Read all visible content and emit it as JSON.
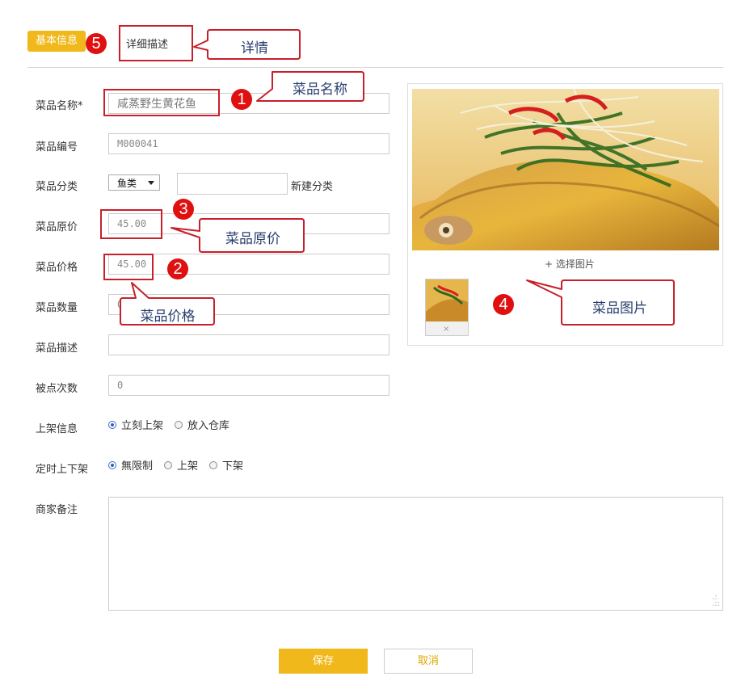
{
  "tabs": {
    "basic": "基本信息",
    "detail": "详细描述"
  },
  "form": {
    "name_label": "菜品名称*",
    "name_value": "咸蒸野生黄花鱼",
    "code_label": "菜品编号",
    "code_value": "M000041",
    "category_label": "菜品分类",
    "category_value": "鱼类",
    "new_category": "新建分类",
    "orig_price_label": "菜品原价",
    "orig_price_value": "45.00",
    "price_label": "菜品价格",
    "price_value": "45.00",
    "qty_label": "菜品数量",
    "qty_value": "0",
    "desc_label": "菜品描述",
    "desc_value": "",
    "orders_label": "被点次数",
    "orders_value": "0",
    "shelf_label": "上架信息",
    "shelf_options": [
      "立刻上架",
      "放入仓库"
    ],
    "timer_label": "定时上下架",
    "timer_options": [
      "無限制",
      "上架",
      "下架"
    ],
    "note_label": "商家备注"
  },
  "image_panel": {
    "choose": "+ 选择图片",
    "remove": "×"
  },
  "buttons": {
    "save": "保存",
    "cancel": "取消"
  },
  "annotations": {
    "n1": "1",
    "n2": "2",
    "n3": "3",
    "n4": "4",
    "n5": "5",
    "c_name": "菜品名称",
    "c_detail": "详情",
    "c_orig_price": "菜品原价",
    "c_price": "菜品价格",
    "c_image": "菜品图片"
  },
  "colors": {
    "accent": "#f0b81a",
    "annotation_red": "#e01010",
    "callout_text": "#2a3f6e"
  },
  "icons": [
    "radio-button",
    "dropdown-arrow",
    "resize-grip-icon",
    "remove-icon"
  ]
}
